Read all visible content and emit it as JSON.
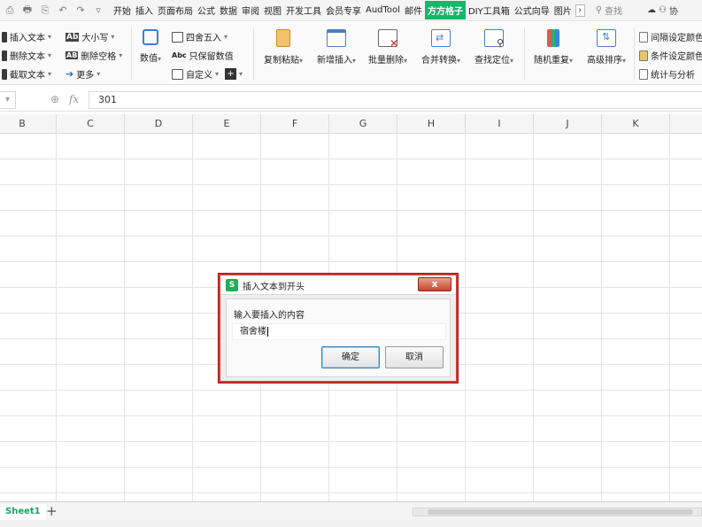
{
  "tabbar": {
    "tabs": [
      "开始",
      "插入",
      "页面布局",
      "公式",
      "数据",
      "审阅",
      "视图",
      "开发工具",
      "会员专享",
      "AudTool",
      "邮件",
      "方方格子",
      "DIY工具箱",
      "公式向导",
      "图片"
    ],
    "active_tab": "方方格子",
    "search_label": "查找",
    "collab_label": "协"
  },
  "ribbon": {
    "insert_text": "插入文本",
    "delete_text": "删除文本",
    "cut_text": "截取文本",
    "case_label": "大小写",
    "delete_space": "删除空格",
    "more": "更多",
    "numeric": "数值",
    "round": "四舍五入",
    "keep_value": "只保留数值",
    "custom": "自定义",
    "copy_paste": "复制粘贴",
    "add_insert": "新增插入",
    "batch_delete": "批量删除",
    "merge_convert": "合并转换",
    "find_locate": "查找定位",
    "random_repeat": "随机重复",
    "advanced_sort": "高级排序",
    "interval_color": "间隔设定颜色",
    "cond_color": "条件设定颜色",
    "stat_analysis": "统计与分析"
  },
  "formula_bar": {
    "fx_label": "fx",
    "value": "301"
  },
  "columns": [
    "B",
    "C",
    "D",
    "E",
    "F",
    "G",
    "H",
    "I",
    "J",
    "K"
  ],
  "sheet": {
    "tab_label": "Sheet1"
  },
  "dialog": {
    "title": "插入文本到开头",
    "logo_letter": "S",
    "close_glyph": "x",
    "prompt": "输入要插入的内容",
    "input_value": "宿舍楼",
    "ok_label": "确定",
    "cancel_label": "取消"
  }
}
